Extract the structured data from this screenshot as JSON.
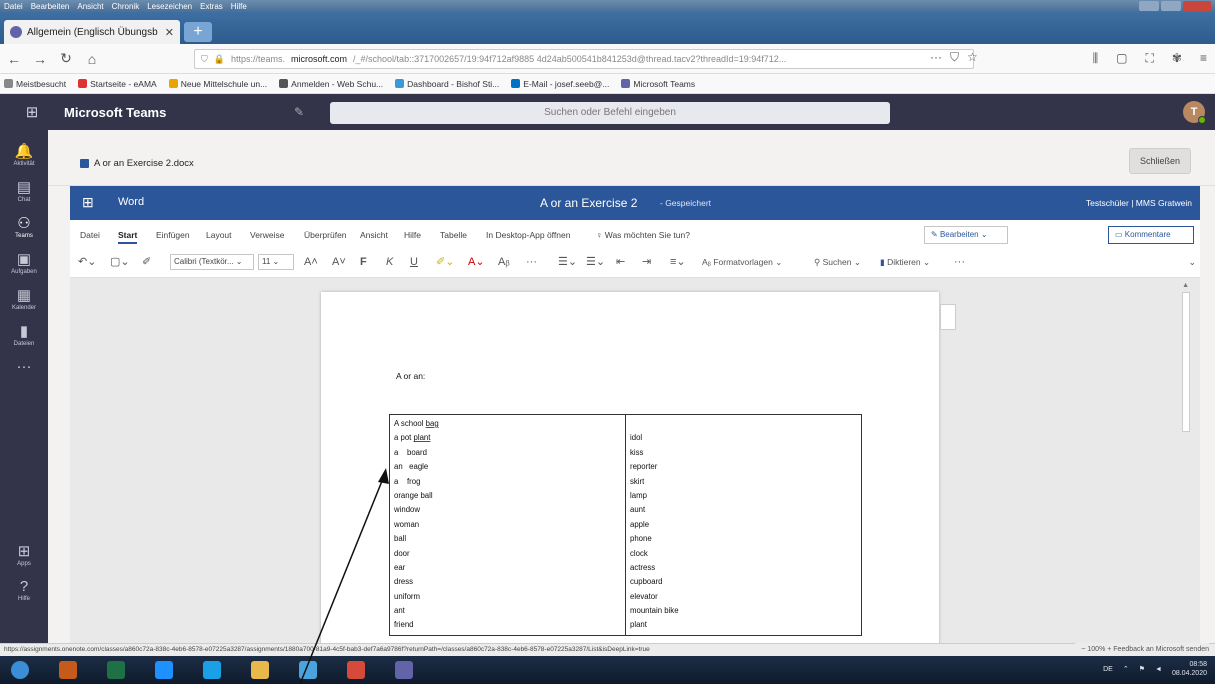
{
  "browser": {
    "menu": [
      "Datei",
      "Bearbeiten",
      "Ansicht",
      "Chronik",
      "Lesezeichen",
      "Extras",
      "Hilfe"
    ],
    "tab_title": "Allgemein (Englisch Übungsb",
    "url_prefix": "https://teams.",
    "url_domain": "microsoft.com",
    "url_rest": "/_#/school/tab::3717002657/19:94f712af9885 4d24ab500541b841253d@thread.tacv2?threadId=19:94f712...",
    "url_dots": "···",
    "bookmarks": [
      {
        "label": "Meistbesucht",
        "color": "#888"
      },
      {
        "label": "Startseite - eAMA",
        "color": "#d33"
      },
      {
        "label": "Neue Mittelschule un...",
        "color": "#e8a400"
      },
      {
        "label": "Anmelden - Web Schu...",
        "color": "#555"
      },
      {
        "label": "Dashboard - Bishof Sti...",
        "color": "#3a9ad9"
      },
      {
        "label": "E-Mail - josef.seeb@...",
        "color": "#0072c6"
      },
      {
        "label": "Microsoft Teams",
        "color": "#6264a7"
      }
    ]
  },
  "teams": {
    "title": "Microsoft Teams",
    "search_placeholder": "Suchen oder Befehl eingeben",
    "avatar_initial": "T",
    "rail": [
      {
        "icon": "bell-icon",
        "label": "Aktivität",
        "glyph": "🔔"
      },
      {
        "icon": "chat-icon",
        "label": "Chat",
        "glyph": "▤"
      },
      {
        "icon": "teams-icon",
        "label": "Teams",
        "glyph": "⚇"
      },
      {
        "icon": "assignments-icon",
        "label": "Aufgaben",
        "glyph": "▣"
      },
      {
        "icon": "calendar-icon",
        "label": "Kalender",
        "glyph": "▦"
      },
      {
        "icon": "files-icon",
        "label": "Dateien",
        "glyph": "▮"
      },
      {
        "icon": "more-icon",
        "label": "",
        "glyph": "···"
      }
    ],
    "rail_bottom": [
      {
        "icon": "apps-icon",
        "label": "Apps",
        "glyph": "⊞"
      },
      {
        "icon": "help-icon",
        "label": "Hilfe",
        "glyph": "?"
      }
    ],
    "file_name": "A or an Exercise 2.docx",
    "close_label": "Schließen"
  },
  "word": {
    "app_name": "Word",
    "doc_title": "A or an Exercise 2",
    "saved_status": "-  Gespeichert",
    "user": "Testschüler | MMS Gratwein",
    "tabs": [
      "Datei",
      "Start",
      "Einfügen",
      "Layout",
      "Verweise",
      "Überprüfen",
      "Ansicht",
      "Hilfe",
      "Tabelle",
      "In Desktop-App öffnen",
      "Was möchten Sie tun?"
    ],
    "active_tab": "Start",
    "edit_label": "Bearbeiten",
    "comment_label": "Kommentare",
    "font_name": "Calibri (Textkör...",
    "font_size": "11",
    "styles_label": "Formatvorlagen",
    "search_label": "Suchen",
    "dictate_label": "Diktieren",
    "more": "···"
  },
  "document": {
    "heading": "A or an:",
    "left_column": [
      {
        "pre": "A school ",
        "word": "bag",
        "spell": true
      },
      {
        "pre": "a pot ",
        "word": "plant",
        "spell": true
      },
      {
        "pre": "a    board",
        "word": "",
        "spell": false
      },
      {
        "pre": "an   eagle",
        "word": "",
        "spell": false
      },
      {
        "pre": "a    frog",
        "word": "",
        "spell": false
      },
      {
        "pre": "orange ball",
        "word": "",
        "spell": false
      },
      {
        "pre": "window",
        "word": "",
        "spell": false
      },
      {
        "pre": "woman",
        "word": "",
        "spell": false
      },
      {
        "pre": "ball",
        "word": "",
        "spell": false
      },
      {
        "pre": "door",
        "word": "",
        "spell": false
      },
      {
        "pre": "ear",
        "word": "",
        "spell": false
      },
      {
        "pre": "dress",
        "word": "",
        "spell": false
      },
      {
        "pre": "uniform",
        "word": "",
        "spell": false
      },
      {
        "pre": "ant",
        "word": "",
        "spell": false
      },
      {
        "pre": "friend",
        "word": "",
        "spell": false
      }
    ],
    "right_column": [
      "",
      "idol",
      "kiss",
      "reporter",
      "skirt",
      "lamp",
      "aunt",
      "apple",
      "phone",
      "clock",
      "actress",
      "cupboard",
      "elevator",
      "mountain bike",
      "plant"
    ]
  },
  "status_url": "https://assignments.onenote.com/classes/a860c72a-838c-4eb6-8578-e07225a3287/assignments/1880a700-81a9-4c5f-bab3-def7a6a9786f?returnPath=/classes/a860c72a-838c-4eb6-8578-e07225a3287/List&isDeepLink=true",
  "zoom_info": "~  100%  +   Feedback an Microsoft senden",
  "taskbar": {
    "apps": [
      {
        "icon": "start-icon",
        "color": "#3b8ed6"
      },
      {
        "icon": "media-icon",
        "color": "#c45b1a"
      },
      {
        "icon": "excel-icon",
        "color": "#1e7145"
      },
      {
        "icon": "ie-icon",
        "color": "#1e90ff"
      },
      {
        "icon": "firefox-icon",
        "color": "#1aa0e6"
      },
      {
        "icon": "explorer-icon",
        "color": "#e8b84a"
      },
      {
        "icon": "refresh-icon",
        "color": "#4aa3df"
      },
      {
        "icon": "chrome-icon",
        "color": "#d64a3c"
      },
      {
        "icon": "teams-app-icon",
        "color": "#6264a7"
      }
    ],
    "lang": "DE",
    "time": "08:58",
    "date": "08.04.2020"
  }
}
